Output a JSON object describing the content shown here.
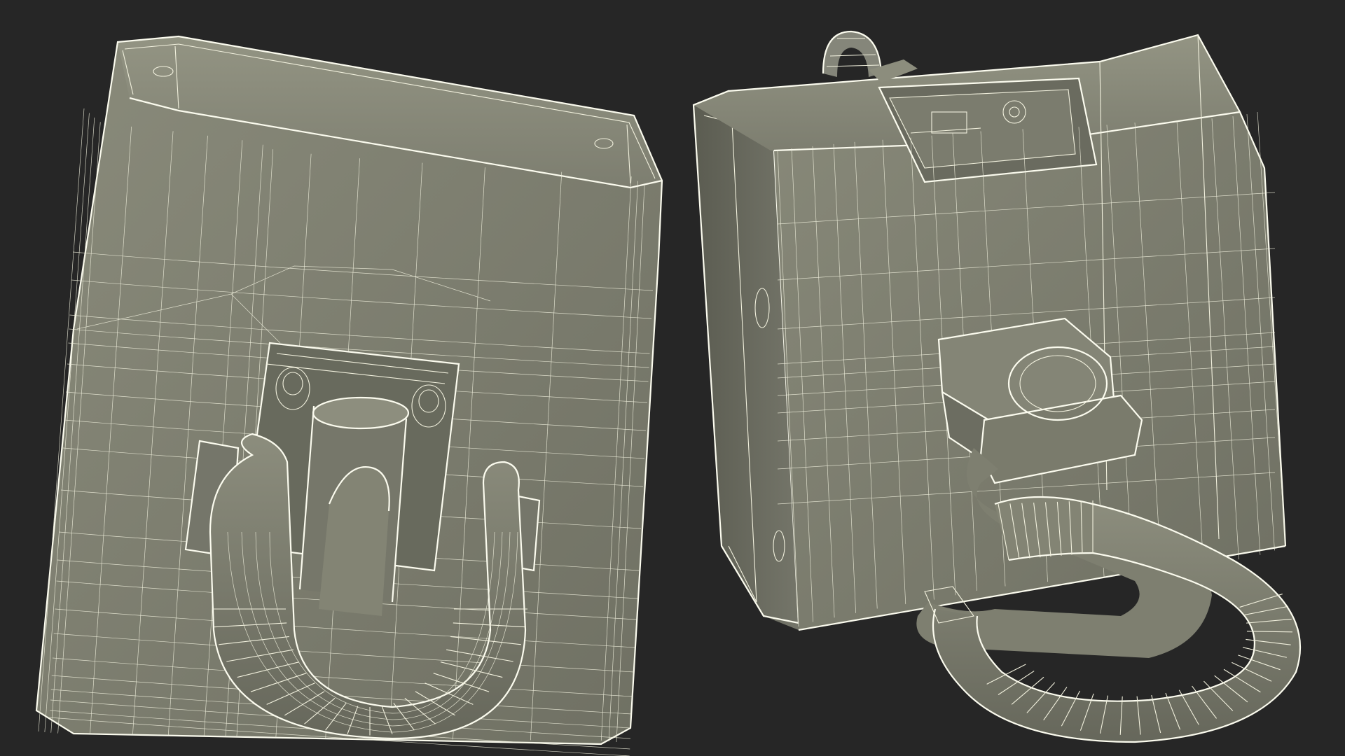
{
  "scene": {
    "description_visible_text": "",
    "background_color": "#262626",
    "model_fill_color": "#7b7c6c",
    "model_fill_dark": "#5f6055",
    "model_fill_light": "#8d8e7e",
    "wire_color": "#f2f1de"
  },
  "views": [
    {
      "name": "front-view",
      "label": ""
    },
    {
      "name": "back-view",
      "label": ""
    }
  ]
}
